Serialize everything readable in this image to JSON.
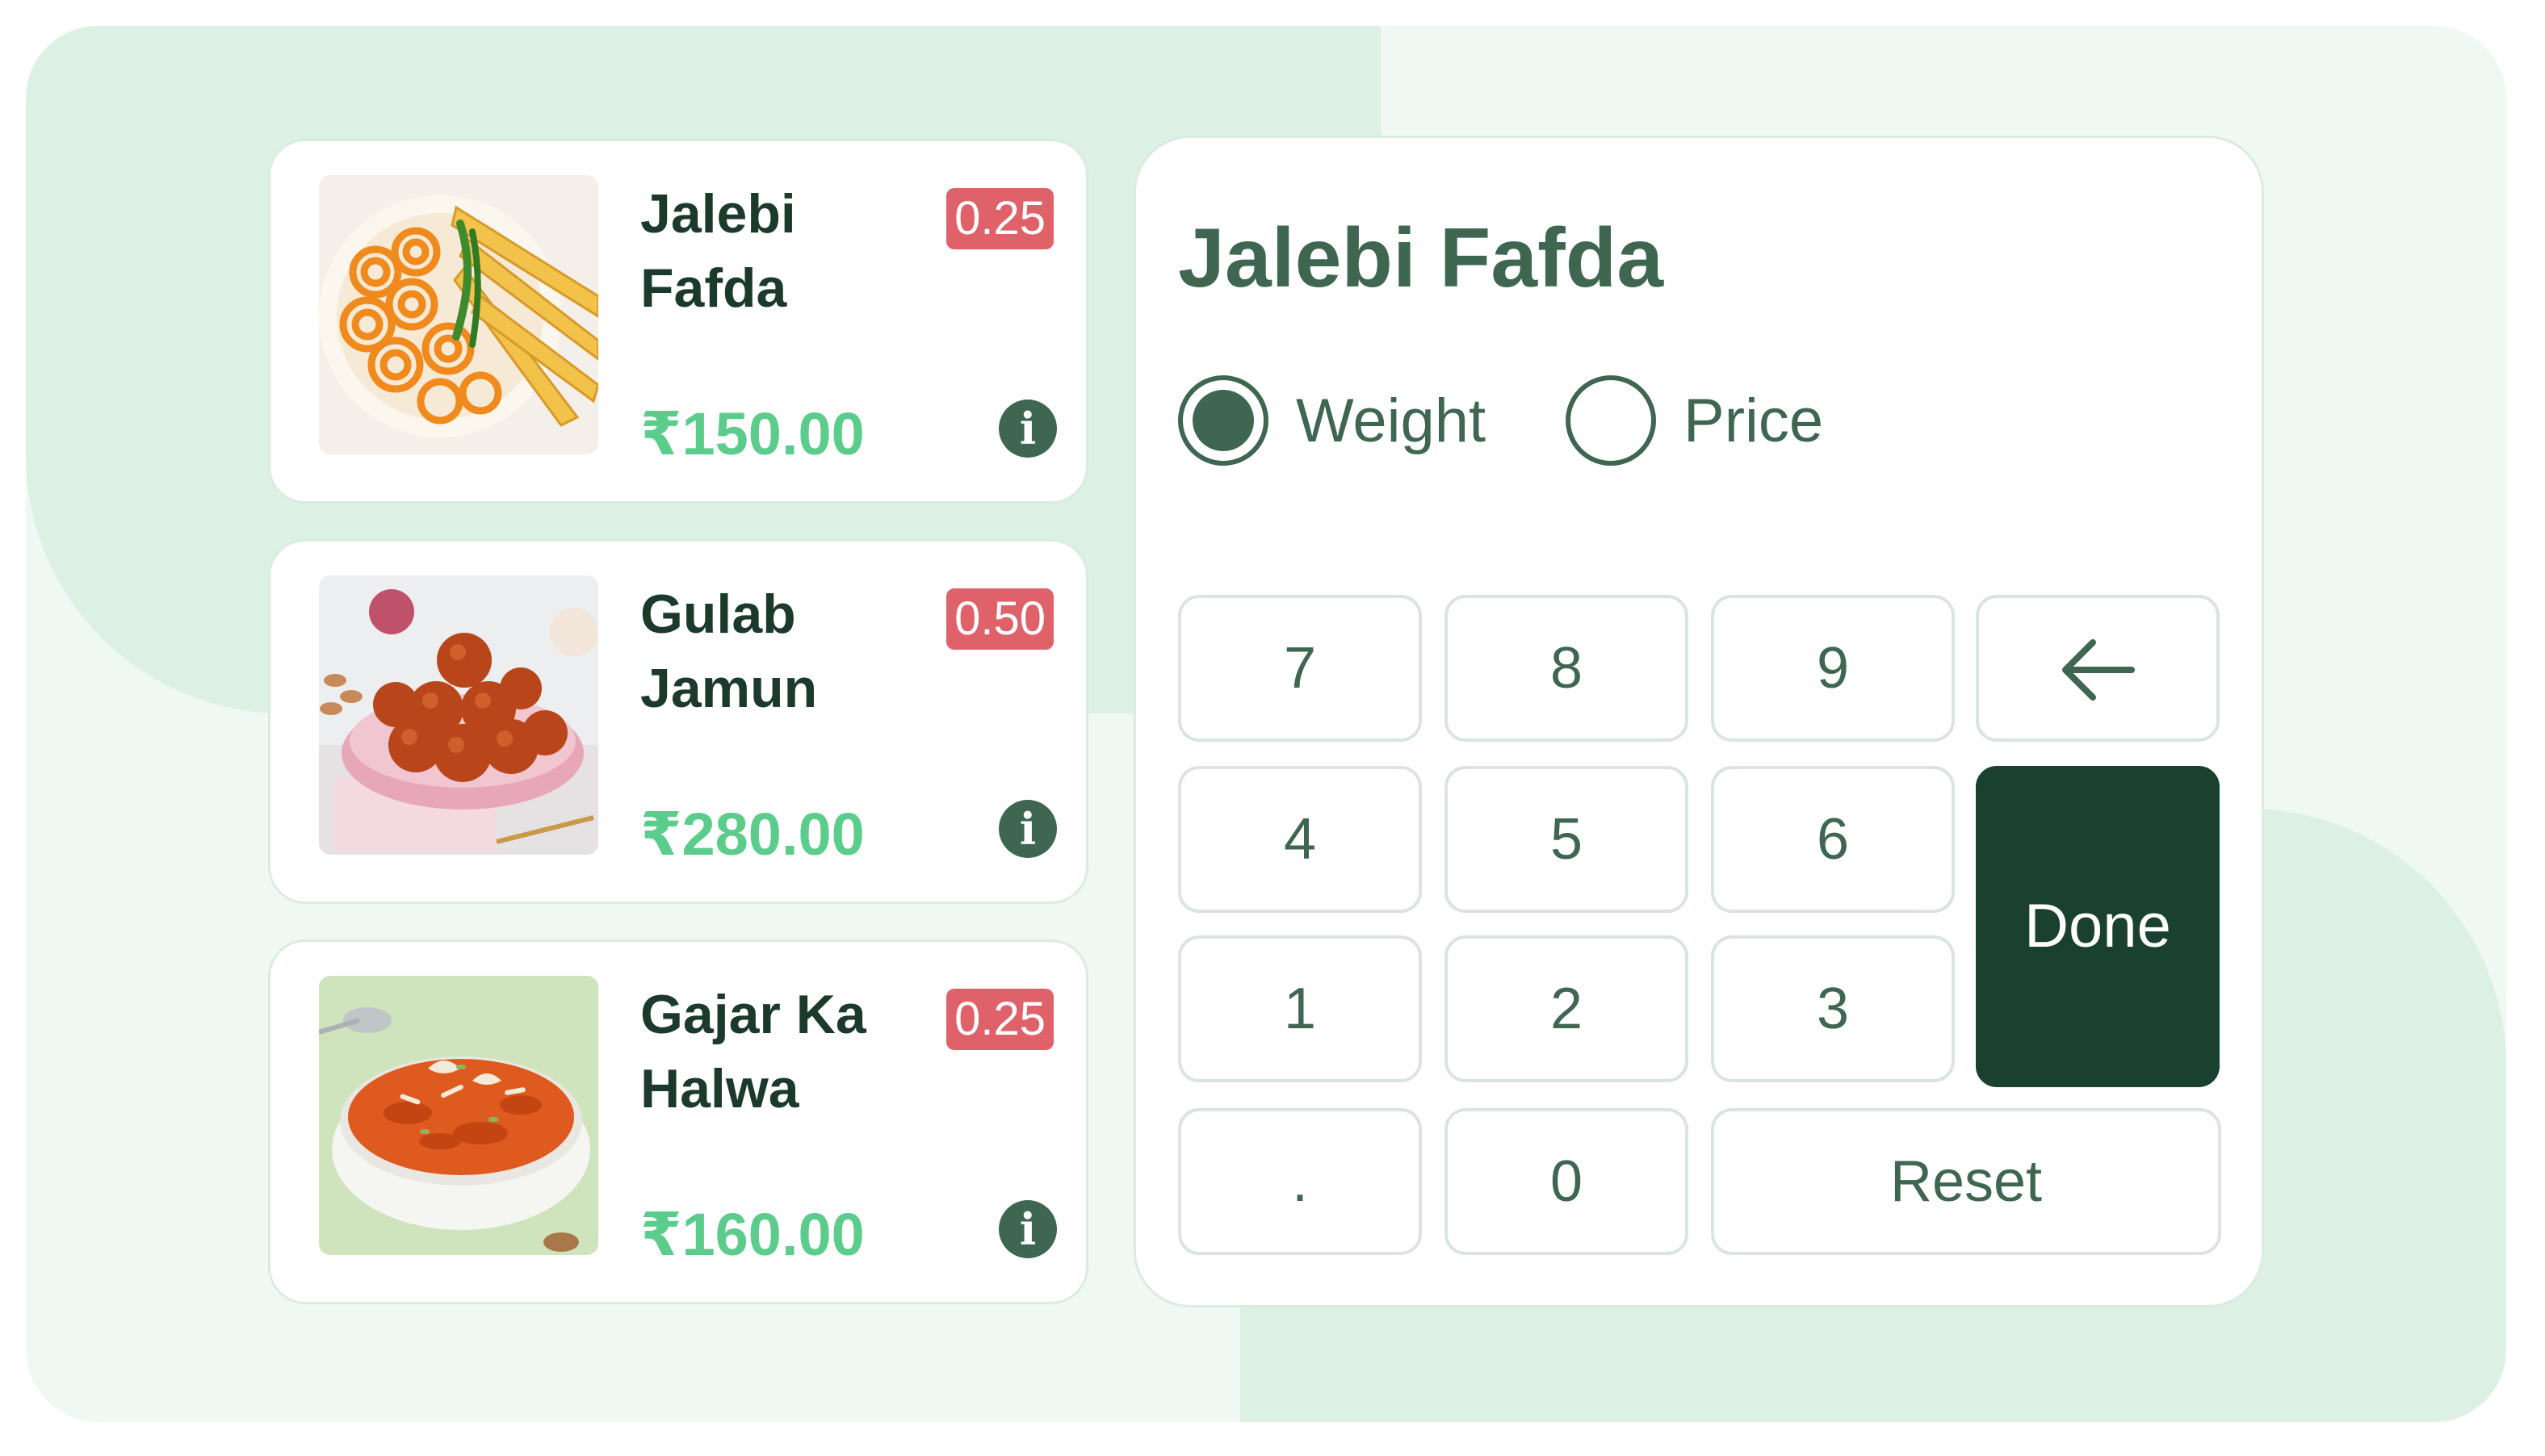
{
  "products": [
    {
      "name_line1": "Jalebi",
      "name_line2": "Fafda",
      "badge": "0.25",
      "price": "₹150.00",
      "info_icon": "i",
      "image": "jalebi-fafda-plate"
    },
    {
      "name_line1": "Gulab",
      "name_line2": "Jamun",
      "badge": "0.50",
      "price": "₹280.00",
      "info_icon": "i",
      "image": "gulab-jamun-bowl"
    },
    {
      "name_line1": "Gajar Ka",
      "name_line2": "Halwa",
      "badge": "0.25",
      "price": "₹160.00",
      "info_icon": "i",
      "image": "gajar-halwa-bowl"
    }
  ],
  "keypad": {
    "title": "Jalebi Fafda",
    "mode_options": [
      {
        "label": "Weight",
        "selected": true
      },
      {
        "label": "Price",
        "selected": false
      }
    ],
    "keys": {
      "k7": "7",
      "k8": "8",
      "k9": "9",
      "backspace_icon": "arrow-left-icon",
      "k4": "4",
      "k5": "5",
      "k6": "6",
      "done": "Done",
      "k1": "1",
      "k2": "2",
      "k3": "3",
      "dot": ".",
      "k0": "0",
      "reset": "Reset"
    }
  },
  "colors": {
    "badge": "#df616a",
    "price": "#5bcc8b",
    "title": "#1b3a2c",
    "accent": "#3f6651",
    "done_button": "#1a4030",
    "background": "#f0f8f3"
  }
}
